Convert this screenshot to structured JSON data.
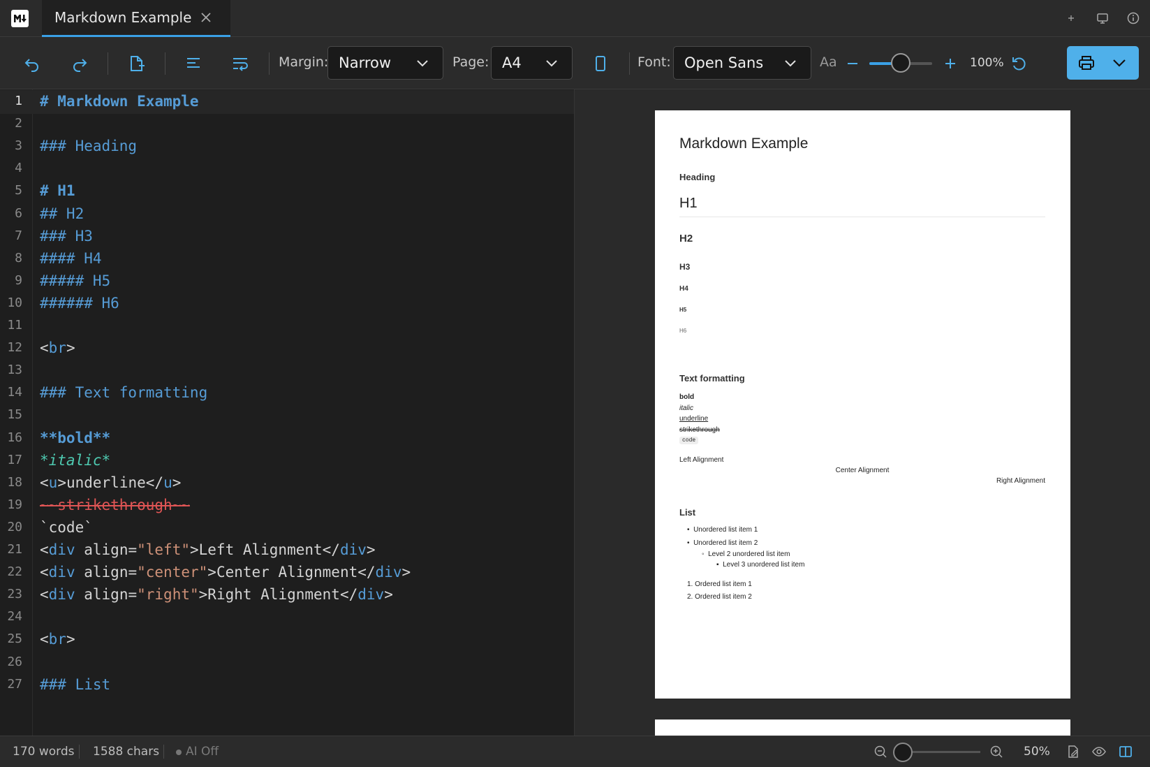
{
  "tab": {
    "title": "Markdown Example"
  },
  "toolbar": {
    "margin_label": "Margin:",
    "margin_value": "Narrow",
    "page_label": "Page:",
    "page_value": "A4",
    "font_label": "Font:",
    "font_value": "Open Sans",
    "font_size_icon_label": "Aa",
    "font_scale_fraction": 0.5,
    "zoom_label": "100%"
  },
  "editor": {
    "line_numbers": [
      "1",
      "2",
      "3",
      "4",
      "5",
      "6",
      "7",
      "8",
      "9",
      "10",
      "11",
      "12",
      "13",
      "14",
      "15",
      "16",
      "17",
      "18",
      "19",
      "20",
      "21",
      "22",
      "23",
      "24",
      "25",
      "26",
      "27"
    ],
    "lines": [
      "# Markdown Example",
      "",
      "### Heading",
      "",
      "# H1",
      "## H2",
      "### H3",
      "#### H4",
      "##### H5",
      "###### H6",
      "",
      "<br>",
      "",
      "### Text formatting",
      "",
      "**bold**",
      "*italic*",
      "<u>underline</u>",
      "~~strikethrough~~",
      "`code`",
      "<div align=\"left\">Left Alignment</div>",
      "<div align=\"center\">Center Alignment</div>",
      "<div align=\"right\">Right Alignment</div>",
      "",
      "<br>",
      "",
      "### List"
    ]
  },
  "preview": {
    "title": "Markdown Example",
    "heading": "Heading",
    "h1": "H1",
    "h2": "H2",
    "h3": "H3",
    "h4": "H4",
    "h5": "H5",
    "h6": "H6",
    "text_formatting": "Text formatting",
    "bold": "bold",
    "italic": "italic",
    "underline": "underline",
    "strikethrough": "strikethrough",
    "code": "code",
    "left_alignment": "Left Alignment",
    "center_alignment": "Center Alignment",
    "right_alignment": "Right Alignment",
    "list_heading": "List",
    "ul": [
      "Unordered list item 1",
      "Unordered list item 2"
    ],
    "ul_level2": "Level 2 unordered list item",
    "ul_level3": "Level 3 unordered list item",
    "ol": [
      "1. Ordered list item 1",
      "2. Ordered list item 2"
    ]
  },
  "status": {
    "words": "170 words",
    "chars": "1588 chars",
    "ai": "AI Off",
    "zoom": "50%",
    "zoom_fraction": 0.0
  },
  "colors": {
    "accent": "#3aa0e6",
    "print_button": "#4fb0ea",
    "heading_syntax": "#569cd6",
    "string": "#ce9178",
    "strike": "#e05555",
    "italic": "#4ec9b0"
  }
}
